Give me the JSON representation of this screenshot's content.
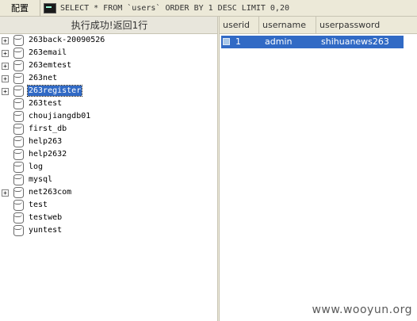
{
  "toolbar": {
    "config_label": "配置",
    "sql_query": "SELECT * FROM `users` ORDER BY 1 DESC LIMIT 0,20"
  },
  "status": {
    "message": "执行成功!返回1行"
  },
  "tree": {
    "items": [
      {
        "label": "263back-20090526",
        "expandable": true,
        "selected": false
      },
      {
        "label": "263email",
        "expandable": true,
        "selected": false
      },
      {
        "label": "263emtest",
        "expandable": true,
        "selected": false
      },
      {
        "label": "263net",
        "expandable": true,
        "selected": false
      },
      {
        "label": "263register",
        "expandable": true,
        "selected": true
      },
      {
        "label": "263test",
        "expandable": false,
        "selected": false
      },
      {
        "label": "choujiangdb01",
        "expandable": false,
        "selected": false
      },
      {
        "label": "first_db",
        "expandable": false,
        "selected": false
      },
      {
        "label": "help263",
        "expandable": false,
        "selected": false
      },
      {
        "label": "help2632",
        "expandable": false,
        "selected": false
      },
      {
        "label": "log",
        "expandable": false,
        "selected": false
      },
      {
        "label": "mysql",
        "expandable": false,
        "selected": false
      },
      {
        "label": "net263com",
        "expandable": true,
        "selected": false
      },
      {
        "label": "test",
        "expandable": false,
        "selected": false
      },
      {
        "label": "testweb",
        "expandable": false,
        "selected": false
      },
      {
        "label": "yuntest",
        "expandable": false,
        "selected": false
      }
    ]
  },
  "grid": {
    "columns": [
      "userid",
      "username",
      "userpassword"
    ],
    "rows": [
      {
        "userid": "1",
        "username": "admin",
        "userpassword": "shihuanews263"
      }
    ]
  },
  "watermark": "www.wooyun.org",
  "colors": {
    "selection": "#316ac5",
    "toolbar_bg": "#ece9d8"
  }
}
